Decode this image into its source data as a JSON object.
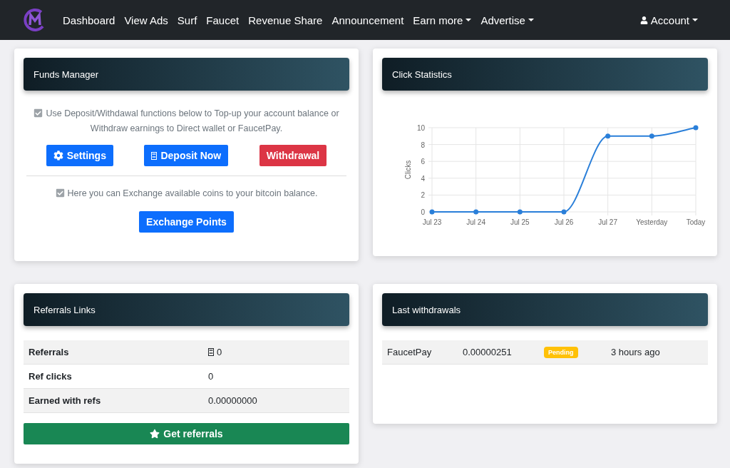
{
  "navbar": {
    "items": [
      {
        "label": "Dashboard",
        "dropdown": false
      },
      {
        "label": "View Ads",
        "dropdown": false
      },
      {
        "label": "Surf",
        "dropdown": false
      },
      {
        "label": "Faucet",
        "dropdown": false
      },
      {
        "label": "Revenue Share",
        "dropdown": false
      },
      {
        "label": "Announcement",
        "dropdown": false
      },
      {
        "label": "Earn more",
        "dropdown": true
      },
      {
        "label": "Advertise",
        "dropdown": true
      }
    ],
    "account": {
      "label": "Account",
      "dropdown": true
    }
  },
  "funds_manager": {
    "title": "Funds Manager",
    "notice": {
      "checked": true,
      "text": "Use Deposit/Withdawal functions below to Top-up your account balance or Withdraw earnings to Direct wallet or FaucetPay."
    },
    "buttons": [
      {
        "label": "Settings",
        "kind": "settings"
      },
      {
        "label": "Deposit Now",
        "kind": "deposit"
      },
      {
        "label": "Withdrawal",
        "kind": "withdrawal"
      }
    ],
    "exchange_notice": {
      "checked": true,
      "text": "Here you can Exchange available coins to your bitcoin balance."
    },
    "exchange_button": "Exchange Points"
  },
  "click_statistics": {
    "title": "Click Statistics",
    "chart_data": {
      "type": "line",
      "ylabel": "Clicks",
      "categories": [
        "Jul 23",
        "Jul 24",
        "Jul 25",
        "Jul 26",
        "Jul 27",
        "Yesterday",
        "Today"
      ],
      "series": [
        {
          "color": "#2a7fd9",
          "marker": true,
          "values": [
            0,
            0,
            0,
            0,
            9,
            9,
            10
          ]
        }
      ],
      "ylim": [
        0,
        10
      ],
      "yticks": [
        0,
        2,
        4,
        6,
        8,
        10
      ],
      "grid": true
    }
  },
  "referrals_links": {
    "title": "Referrals Links",
    "rows": [
      {
        "label": "Referrals",
        "value": "0",
        "icon": true
      },
      {
        "label": "Ref clicks",
        "value": "0",
        "icon": false
      },
      {
        "label": "Earned with refs",
        "value": "0.00000000",
        "icon": false
      }
    ],
    "button": "Get referrals"
  },
  "last_withdrawals": {
    "title": "Last withdrawals",
    "rows": [
      {
        "method": "FaucetPay",
        "amount": "0.00000251",
        "status": "Pending",
        "time": "3 hours ago"
      }
    ]
  }
}
